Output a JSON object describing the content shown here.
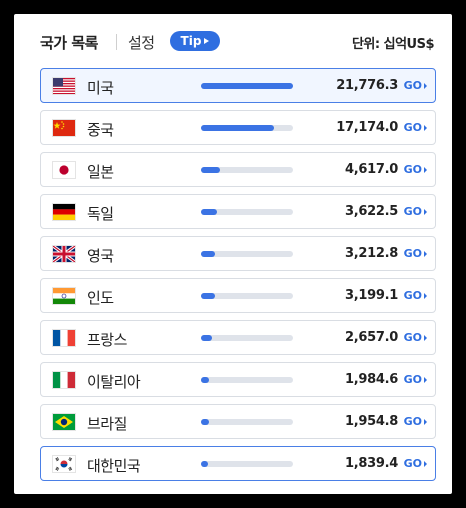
{
  "header": {
    "title": "국가 목록",
    "settings": "설정",
    "tip": "Tip",
    "unit": "단위: 십억US$"
  },
  "go_label": "GO",
  "accent_color": "#2f6ee0",
  "countries": [
    {
      "name": "미국",
      "flag": "us-flag-icon",
      "value": "21,776.3",
      "share": 1.0
    },
    {
      "name": "중국",
      "flag": "cn-flag-icon",
      "value": "17,174.0",
      "share": 0.79
    },
    {
      "name": "일본",
      "flag": "jp-flag-icon",
      "value": "4,617.0",
      "share": 0.21
    },
    {
      "name": "독일",
      "flag": "de-flag-icon",
      "value": "3,622.5",
      "share": 0.17
    },
    {
      "name": "영국",
      "flag": "gb-flag-icon",
      "value": "3,212.8",
      "share": 0.15
    },
    {
      "name": "인도",
      "flag": "in-flag-icon",
      "value": "3,199.1",
      "share": 0.15
    },
    {
      "name": "프랑스",
      "flag": "fr-flag-icon",
      "value": "2,657.0",
      "share": 0.12
    },
    {
      "name": "이탈리아",
      "flag": "it-flag-icon",
      "value": "1,984.6",
      "share": 0.09
    },
    {
      "name": "브라질",
      "flag": "br-flag-icon",
      "value": "1,954.8",
      "share": 0.09
    },
    {
      "name": "대한민국",
      "flag": "kr-flag-icon",
      "value": "1,839.4",
      "share": 0.08
    }
  ]
}
